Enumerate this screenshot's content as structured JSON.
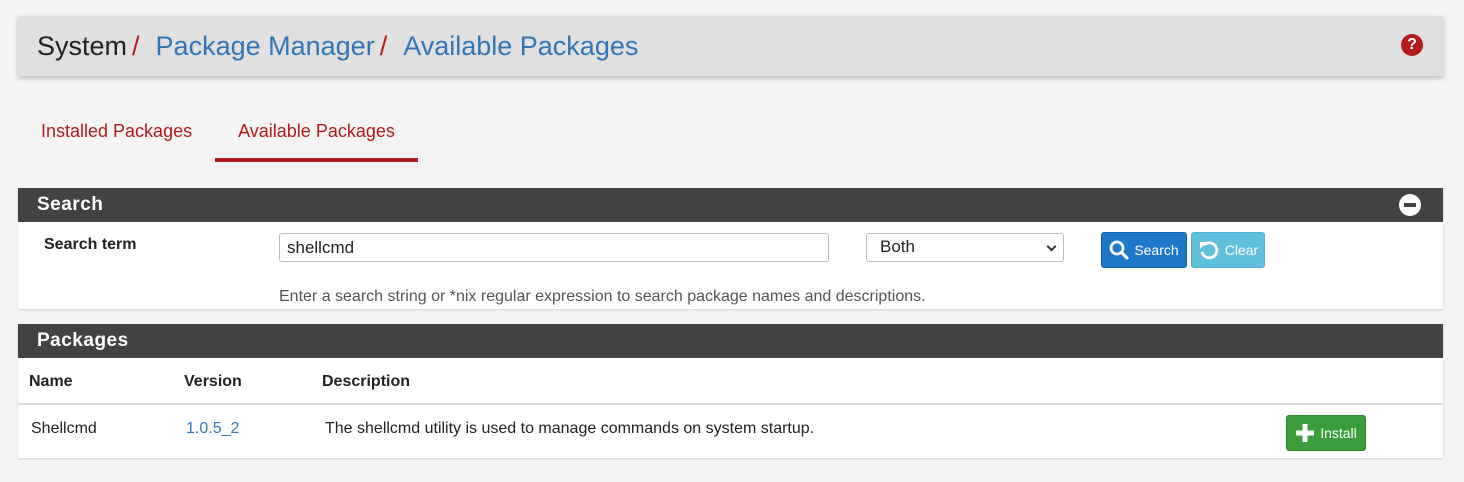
{
  "breadcrumb": {
    "root": "System",
    "separator": "/",
    "items": [
      "Package Manager",
      "Available Packages"
    ]
  },
  "help_icon": "question-circle-icon",
  "tabs": [
    {
      "label": "Installed Packages",
      "active": false
    },
    {
      "label": "Available Packages",
      "active": true
    }
  ],
  "search": {
    "heading": "Search",
    "term_label": "Search term",
    "term_value": "shellcmd",
    "scope_selected": "Both",
    "search_button": "Search",
    "clear_button": "Clear",
    "help_text": "Enter a search string or *nix regular expression to search package names and descriptions."
  },
  "packages": {
    "heading": "Packages",
    "columns": [
      "Name",
      "Version",
      "Description"
    ],
    "rows": [
      {
        "name": "Shellcmd",
        "version": "1.0.5_2",
        "description": "The shellcmd utility is used to manage commands on system startup.",
        "action": "Install"
      }
    ]
  },
  "colors": {
    "accent_red": "#b31b1b",
    "link_blue": "#3375b7",
    "panel_heading": "#424242",
    "search_button": "#1e78c9",
    "clear_button": "#60c0dc",
    "install_button": "#3c9d3c"
  }
}
